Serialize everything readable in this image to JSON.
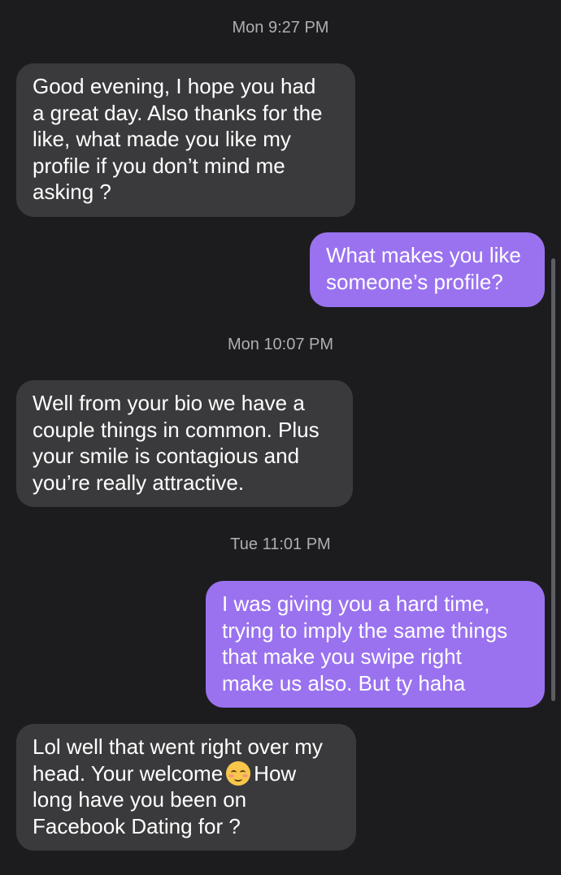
{
  "thread": {
    "items": [
      {
        "type": "timestamp",
        "text": "Mon 9:27 PM"
      },
      {
        "type": "message",
        "direction": "incoming",
        "lines": [
          "Good evening, I hope you had",
          "a great day. Also thanks for the",
          "like, what made you like my",
          "profile if you don’t mind me",
          "asking ?"
        ]
      },
      {
        "type": "message",
        "direction": "outgoing",
        "lines": [
          "What makes you like",
          "someone’s profile?"
        ]
      },
      {
        "type": "timestamp",
        "text": "Mon 10:07 PM"
      },
      {
        "type": "message",
        "direction": "incoming",
        "lines": [
          "Well from your bio we have a",
          "couple things in common. Plus",
          "your smile is contagious and",
          "you’re really attractive."
        ]
      },
      {
        "type": "timestamp",
        "text": "Tue 11:01 PM"
      },
      {
        "type": "message",
        "direction": "outgoing",
        "lines": [
          "I was giving you a hard time,",
          "trying to imply the same things",
          "that make you swipe right",
          "make us also. But ty haha"
        ]
      },
      {
        "type": "message",
        "direction": "incoming",
        "lines": [
          "Lol well that went right over my",
          "head. Your welcome",
          "How",
          "long have you been on",
          "Facebook Dating for ?"
        ],
        "emoji": "smiling-face-icon"
      }
    ]
  },
  "colors": {
    "background": "#1c1c1e",
    "incoming_bubble": "#3a3a3c",
    "outgoing_bubble": "#9a72ef",
    "timestamp_text": "#aeaeb2"
  }
}
